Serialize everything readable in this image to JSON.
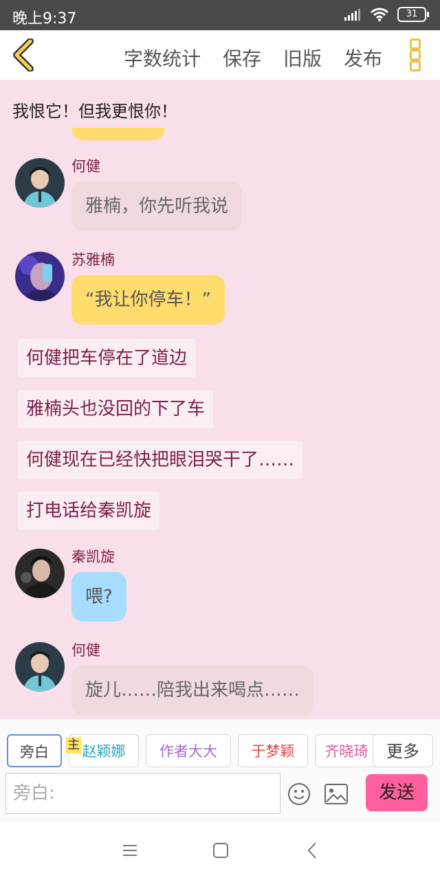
{
  "status_bar": {
    "time": "晚上9:37",
    "battery": "31"
  },
  "toolbar": {
    "items": [
      "字数统计",
      "保存",
      "旧版",
      "发布"
    ]
  },
  "pinned_text": "我恨它！但我更恨你！",
  "messages": [
    {
      "sender": "何健",
      "text": "雅楠，你先听我说",
      "style": "gray"
    },
    {
      "sender": "苏雅楠",
      "text": "“我让你停车！”",
      "style": "yellow"
    },
    {
      "narration": "何健把车停在了道边"
    },
    {
      "narration": "雅楠头也没回的下了车"
    },
    {
      "narration": "何健现在已经快把眼泪哭干了……"
    },
    {
      "narration": "打电话给秦凯旋"
    },
    {
      "sender": "秦凯旋",
      "text": "喂?",
      "style": "blue"
    },
    {
      "sender": "何健",
      "text": "旋儿……陪我出来喝点……",
      "style": "gray"
    }
  ],
  "role_chips": [
    {
      "label": "旁白",
      "color": "#444444"
    },
    {
      "label": "赵颖娜",
      "color": "#2aa8b8"
    },
    {
      "label": "作者大大",
      "color": "#a86ad6"
    },
    {
      "label": "于梦颖",
      "color": "#e04848"
    },
    {
      "label": "齐晓琦",
      "color": "#e05a9a"
    },
    {
      "label": "更多",
      "color": "#444444"
    }
  ],
  "main_tag": "主",
  "input": {
    "placeholder": "旁白:"
  },
  "send_label": "发送",
  "colors": {
    "accent_pink": "#ff5f9c",
    "chat_bg": "#f8dfe9",
    "yellow_bubble": "#ffdc6c",
    "blue_bubble": "#a8dcff"
  }
}
